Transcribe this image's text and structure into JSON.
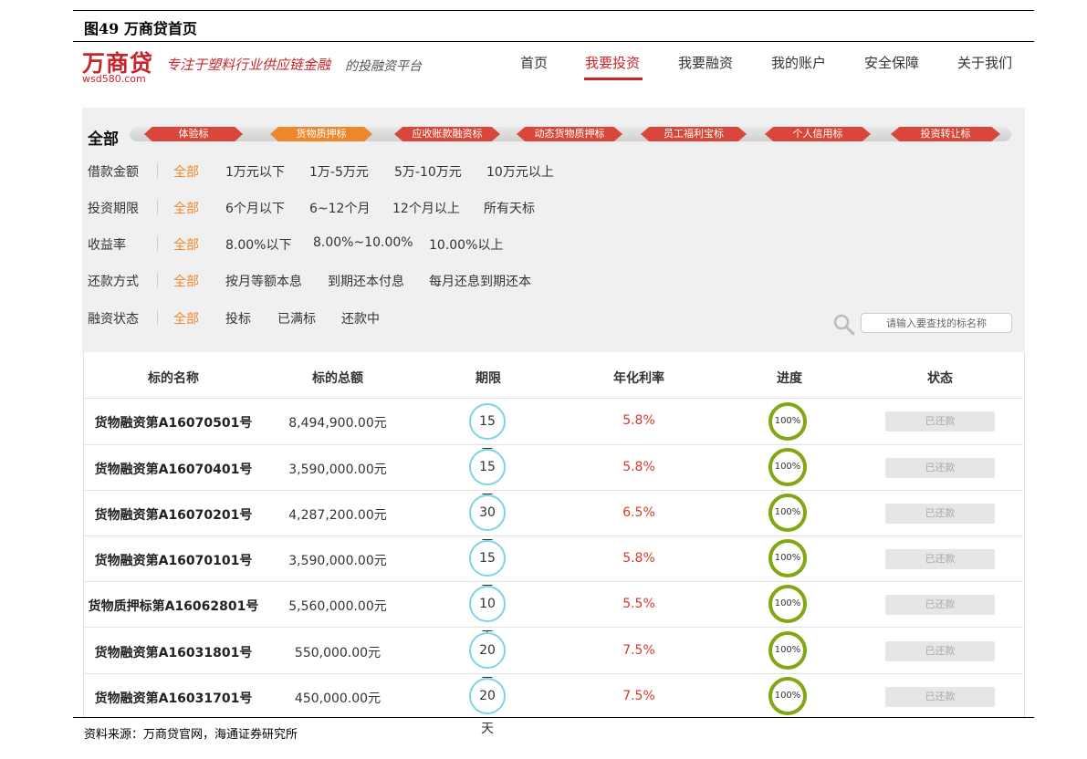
{
  "figure": {
    "title": "图49 万商贷首页",
    "source": "资料来源：万商贷官网，海通证券研究所"
  },
  "header": {
    "logo_main": "万商贷",
    "logo_sub": "wsd580.com",
    "slogan_red": "专注于塑料行业供应链金融",
    "slogan_gray": "的投融资平台",
    "nav": [
      {
        "label": "首页"
      },
      {
        "label": "我要投资",
        "active": true
      },
      {
        "label": "我要融资"
      },
      {
        "label": "我的账户"
      },
      {
        "label": "安全保障"
      },
      {
        "label": "关于我们"
      }
    ]
  },
  "filters": {
    "all_label": "全部",
    "categories": [
      "体验标",
      "货物质押标",
      "应收账款融资标",
      "动态货物质押标",
      "员工福利宝标",
      "个人信用标",
      "投资转让标"
    ],
    "selected_category": "货物质押标",
    "rows": [
      {
        "label": "借款金额",
        "options": [
          "全部",
          "1万元以下",
          "1万-5万元",
          "5万-10万元",
          "10万元以上"
        ]
      },
      {
        "label": "投资期限",
        "options": [
          "全部",
          "6个月以下",
          "6~12个月",
          "12个月以上",
          "所有天标"
        ]
      },
      {
        "label": "收益率",
        "options": [
          "全部",
          "8.00%以下",
          "8.00%~10.00%",
          "10.00%以上"
        ]
      },
      {
        "label": "还款方式",
        "options": [
          "全部",
          "按月等额本息",
          "到期还本付息",
          "每月还息到期还本"
        ]
      },
      {
        "label": "融资状态",
        "options": [
          "全部",
          "投标",
          "已满标",
          "还款中"
        ]
      }
    ]
  },
  "search": {
    "placeholder": "请输入要查找的标名称"
  },
  "table": {
    "columns": [
      "标的名称",
      "标的总额",
      "期限",
      "年化利率",
      "进度",
      "状态"
    ],
    "rows": [
      {
        "name": "货物融资第A16070501号",
        "amount": "8,494,900.00元",
        "term": "15 天",
        "rate": "5.8%",
        "progress": "100%",
        "status": "已还款"
      },
      {
        "name": "货物融资第A16070401号",
        "amount": "3,590,000.00元",
        "term": "15 天",
        "rate": "5.8%",
        "progress": "100%",
        "status": "已还款"
      },
      {
        "name": "货物融资第A16070201号",
        "amount": "4,287,200.00元",
        "term": "30 天",
        "rate": "6.5%",
        "progress": "100%",
        "status": "已还款"
      },
      {
        "name": "货物融资第A16070101号",
        "amount": "3,590,000.00元",
        "term": "15 天",
        "rate": "5.8%",
        "progress": "100%",
        "status": "已还款"
      },
      {
        "name": "货物质押标第A16062801号",
        "amount": "5,560,000.00元",
        "term": "10 天",
        "rate": "5.5%",
        "progress": "100%",
        "status": "已还款"
      },
      {
        "name": "货物融资第A16031801号",
        "amount": "550,000.00元",
        "term": "20 天",
        "rate": "7.5%",
        "progress": "100%",
        "status": "已还款"
      },
      {
        "name": "货物融资第A16031701号",
        "amount": "450,000.00元",
        "term": "20 天",
        "rate": "7.5%",
        "progress": "100%",
        "status": "已还款"
      }
    ]
  },
  "colors": {
    "brand_red": "#c8242b",
    "selected_orange": "#f0862c",
    "rate_red": "#d43a2a",
    "term_circle": "#7dd3ea",
    "progress_green": "#82a614"
  }
}
